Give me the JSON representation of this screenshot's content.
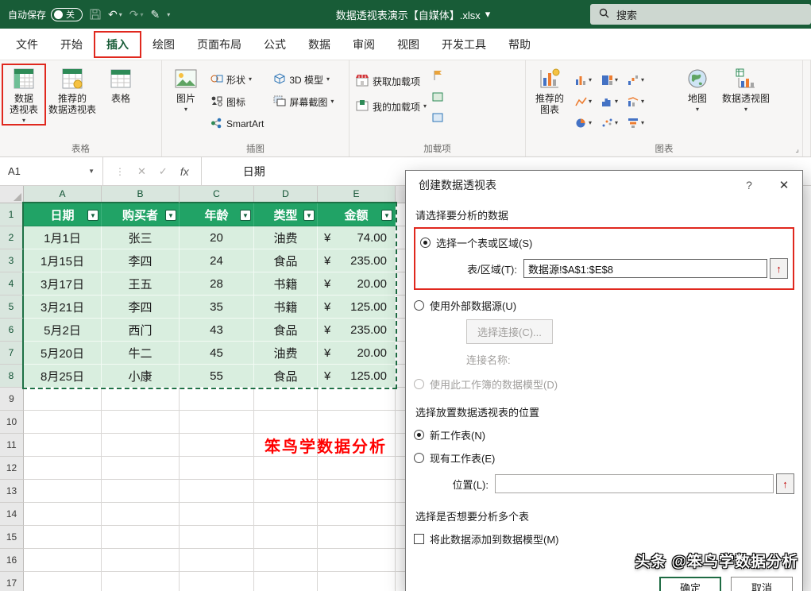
{
  "titlebar": {
    "autosave_label": "自动保存",
    "autosave_state": "关",
    "title": "数据透视表演示【自媒体】.xlsx",
    "search": "搜索"
  },
  "ribbon": {
    "tabs": [
      "文件",
      "开始",
      "插入",
      "绘图",
      "页面布局",
      "公式",
      "数据",
      "审阅",
      "视图",
      "开发工具",
      "帮助"
    ],
    "active_tab": "插入",
    "tables_group": {
      "label": "表格",
      "pivot": "数据\n透视表",
      "recommended": "推荐的\n数据透视表",
      "table": "表格"
    },
    "illustrations_group": {
      "label": "插图",
      "picture": "图片",
      "shapes": "形状",
      "icons": "图标",
      "model3d": "3D 模型",
      "smartart": "SmartArt",
      "screenshot": "屏幕截图"
    },
    "addins_group": {
      "label": "加载项",
      "get": "获取加载项",
      "mine": "我的加载项"
    },
    "charts_group": {
      "label": "图表",
      "recommended": "推荐的\n图表",
      "maps": "地图",
      "pivotchart": "数据透视图"
    }
  },
  "formula_bar": {
    "name_box": "A1",
    "fx": "fx",
    "content": "日期"
  },
  "sheet": {
    "columns": [
      "A",
      "B",
      "C",
      "D",
      "E"
    ],
    "row_count": 17,
    "table": {
      "headers": [
        "日期",
        "购买者",
        "年龄",
        "类型",
        "金额"
      ],
      "currency": "¥",
      "rows": [
        [
          "1月1日",
          "张三",
          "20",
          "油费",
          "74.00"
        ],
        [
          "1月15日",
          "李四",
          "24",
          "食品",
          "235.00"
        ],
        [
          "3月17日",
          "王五",
          "28",
          "书籍",
          "20.00"
        ],
        [
          "3月21日",
          "李四",
          "35",
          "书籍",
          "125.00"
        ],
        [
          "5月2日",
          "西门",
          "43",
          "食品",
          "235.00"
        ],
        [
          "5月20日",
          "牛二",
          "45",
          "油费",
          "20.00"
        ],
        [
          "8月25日",
          "小康",
          "55",
          "食品",
          "125.00"
        ]
      ]
    },
    "annotation": "笨鸟学数据分析"
  },
  "dialog": {
    "title": "创建数据透视表",
    "section_data": "请选择要分析的数据",
    "radio_select_range": "选择一个表或区域(S)",
    "range_label": "表/区域(T):",
    "range_value": "数据源!$A$1:$E$8",
    "radio_external": "使用外部数据源(U)",
    "choose_connection": "选择连接(C)...",
    "connection_name": "连接名称:",
    "radio_data_model": "使用此工作簿的数据模型(D)",
    "section_placement": "选择放置数据透视表的位置",
    "radio_new_sheet": "新工作表(N)",
    "radio_existing": "现有工作表(E)",
    "location_label": "位置(L):",
    "section_multi": "选择是否想要分析多个表",
    "checkbox_model": "将此数据添加到数据模型(M)",
    "ok": "确定",
    "cancel": "取消"
  },
  "watermark": "头条 @笨鸟学数据分析",
  "icons": {
    "chevron_down": "▾",
    "dropdown": "▼",
    "filter": "▼",
    "range_picker": "↑",
    "undo": "↶",
    "redo": "↷",
    "pen": "✎",
    "dots": "⋮",
    "cancel_x": "✕",
    "check": "✓",
    "help": "?",
    "close": "✕",
    "dialog_launcher": "⌟"
  },
  "colors": {
    "brand_green": "#185C37",
    "table_header_green": "#21A366",
    "table_fill_green": "#D9EEDF",
    "annotation_red": "#FF0000"
  }
}
